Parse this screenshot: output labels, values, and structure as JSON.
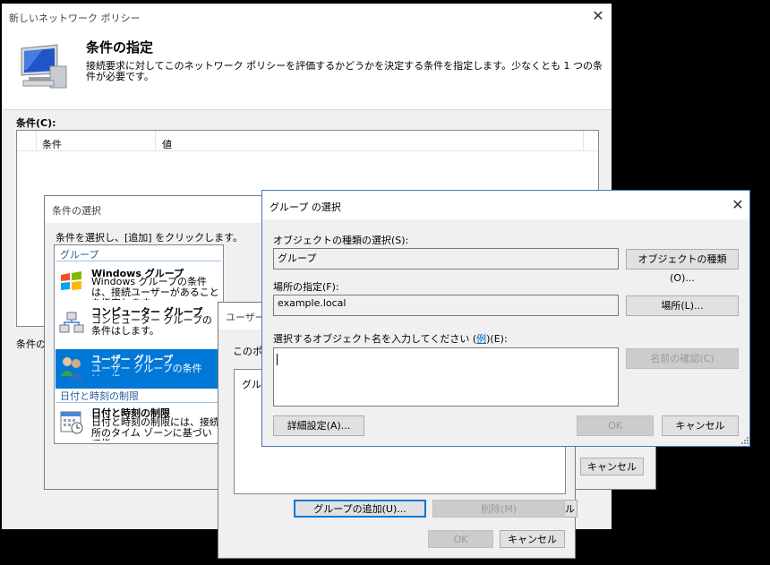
{
  "main_window": {
    "title": "新しいネットワーク ポリシー",
    "heading": "条件の指定",
    "description": "接続要求に対してこのネットワーク ポリシーを評価するかどうかを決定する条件を指定します。少なくとも 1 つの条件が必要です。",
    "conditions_label": "条件(C):",
    "col_condition": "条件",
    "col_value": "値",
    "condition_desc_label": "条件の"
  },
  "select_condition": {
    "title": "条件の選択",
    "instruction": "条件を選択し、[追加] をクリックします。",
    "group_header": "グループ",
    "items": [
      {
        "title": "Windows グループ",
        "desc": "Windows グループの条件は、接続ユーザーがあることを指定します。"
      },
      {
        "title": "コンピューター グループ",
        "desc": "コンピューター グループの条件はします。"
      },
      {
        "title": "ユーザー グループ",
        "desc": "ユーザー グループの条件は、指"
      }
    ],
    "date_header": "日付と時刻の制限",
    "date_item": {
      "title": "日付と時刻の制限",
      "desc": "日付と時刻の制限には、接続所のタイム ゾーンに基づいて指"
    },
    "cancel_label": "キャンセル"
  },
  "user_groups": {
    "title": "ユーザー",
    "subtitle": "このポリ",
    "list_text": "グル",
    "add_group_label": "グループの追加(U)...",
    "delete_label": "削除(M)",
    "ok_label": "OK",
    "cancel_label": "キャンセル",
    "behind_button_fragment": "ル"
  },
  "select_group": {
    "title": "グループ の選択",
    "object_type_label": "オブジェクトの種類の選択(S):",
    "object_type_value": "グループ",
    "object_types_button": "オブジェクトの種類(O)...",
    "location_label": "場所の指定(F):",
    "location_value": "example.local",
    "locations_button": "場所(L)...",
    "names_label": "選択するオブジェクト名を入力してください (",
    "names_label_link": "例",
    "names_label_end": ")(E):",
    "check_names_button": "名前の確認(C)",
    "advanced_button": "詳細設定(A)...",
    "ok_label": "OK",
    "cancel_label": "キャンセル"
  }
}
